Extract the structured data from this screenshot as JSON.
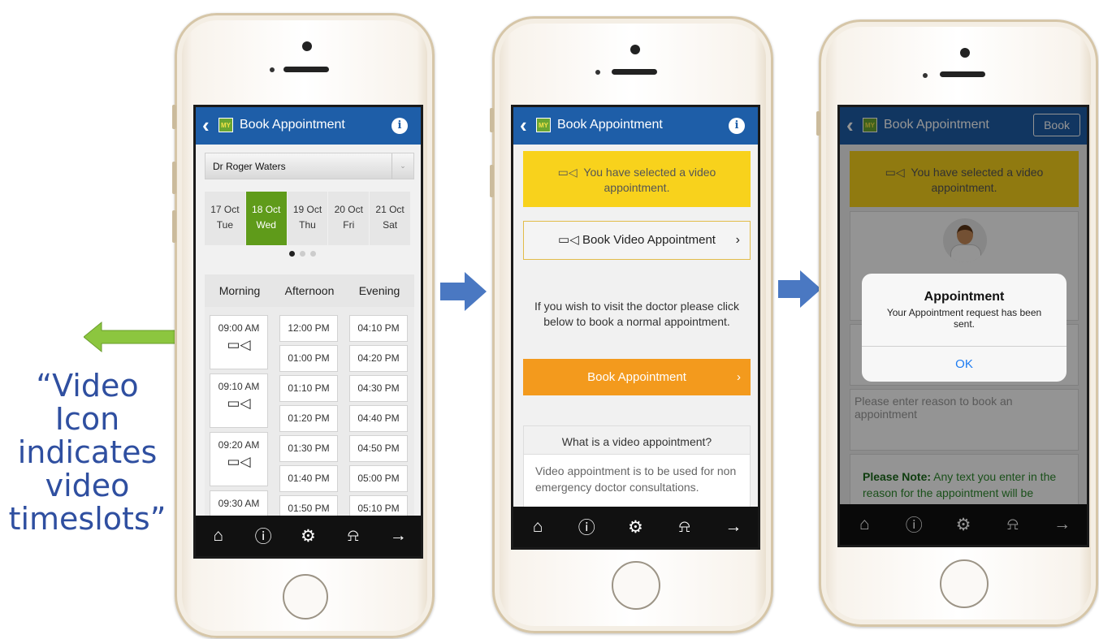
{
  "caption": {
    "line1": "“Video Icon",
    "line2": "indicates",
    "line3": "video",
    "line4": "timeslots”"
  },
  "colors": {
    "nav_blue": "#1e5ea8",
    "selected_green": "#5f9b1a",
    "banner_yellow": "#f8d21c",
    "book_orange": "#f39a1d",
    "arrow_green": "#8cc63f",
    "arrow_blue": "#4a78c2"
  },
  "screen1": {
    "title": "Book Appointment",
    "doctor": "Dr Roger Waters",
    "dates": [
      {
        "day": "17 Oct",
        "weekday": "Tue",
        "selected": false
      },
      {
        "day": "18 Oct",
        "weekday": "Wed",
        "selected": true
      },
      {
        "day": "19 Oct",
        "weekday": "Thu",
        "selected": false
      },
      {
        "day": "20 Oct",
        "weekday": "Fri",
        "selected": false
      },
      {
        "day": "21 Oct",
        "weekday": "Sat",
        "selected": false
      }
    ],
    "columns": [
      "Morning",
      "Afternoon",
      "Evening"
    ],
    "morning": [
      "09:00 AM",
      "09:10 AM",
      "09:20 AM",
      "09:30 AM"
    ],
    "afternoon": [
      "12:00 PM",
      "01:00 PM",
      "01:10 PM",
      "01:20 PM",
      "01:30 PM",
      "01:40 PM",
      "01:50 PM"
    ],
    "evening": [
      "04:10 PM",
      "04:20 PM",
      "04:30 PM",
      "04:40 PM",
      "04:50 PM",
      "05:00 PM",
      "05:10 PM"
    ]
  },
  "screen2": {
    "title": "Book Appointment",
    "banner": "You have selected a video appointment.",
    "video_button": "Book Video Appointment",
    "hint": "If you wish to visit the doctor please click below to book a normal appointment.",
    "normal_button": "Book Appointment",
    "faq_question": "What is a video appointment?",
    "faq_answer": "Video appointment is to be used for non emergency doctor consultations."
  },
  "screen3": {
    "title": "Book Appointment",
    "book_button": "Book",
    "banner": "You have selected a video appointment.",
    "reason_placeholder": "Please enter reason to book an appointment",
    "note_label": "Please Note:",
    "note_text": " Any text you enter in the reason for the appointment will be visible to the reception staff in the",
    "alert_title": "Appointment",
    "alert_message": "Your Appointment request has been sent.",
    "alert_ok": "OK"
  },
  "tabbar_icons": [
    "home-icon",
    "info-icon",
    "settings-icon",
    "bell-icon",
    "logout-icon"
  ]
}
